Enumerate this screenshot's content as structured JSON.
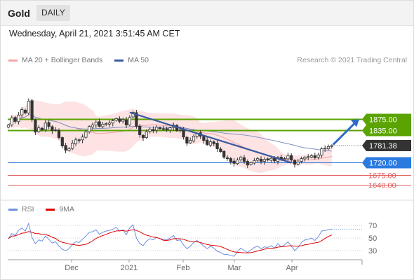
{
  "header": {
    "asset": "Gold",
    "timeframe": "DAILY"
  },
  "timestamp": "Wednesday, April 21, 2021 3:51:45 AM CET",
  "legend": [
    {
      "label": "MA 20 + Bollinger Bands",
      "color": "#f08a8a"
    },
    {
      "label": "MA 50",
      "color": "#3b5aa0"
    }
  ],
  "credit": "Research © 2021 Trading Central",
  "rsi_legend": [
    {
      "label": "RSI",
      "color": "#6f8fe0"
    },
    {
      "label": "9MA",
      "color": "#e00000"
    }
  ],
  "chart_data": [
    {
      "type": "candlestick",
      "x_ticks": [
        "Dec",
        "2021",
        "Feb",
        "Mar",
        "Apr"
      ],
      "closes": [
        1855,
        1880,
        1868,
        1890,
        1910,
        1898,
        1940,
        1875,
        1830,
        1845,
        1838,
        1862,
        1850,
        1835,
        1838,
        1810,
        1780,
        1765,
        1770,
        1790,
        1802,
        1800,
        1812,
        1830,
        1850,
        1855,
        1865,
        1850,
        1858,
        1860,
        1862,
        1870,
        1878,
        1868,
        1875,
        1855,
        1882,
        1900,
        1850,
        1820,
        1810,
        1830,
        1840,
        1835,
        1847,
        1842,
        1840,
        1838,
        1845,
        1855,
        1835,
        1838,
        1812,
        1790,
        1800,
        1815,
        1825,
        1815,
        1800,
        1785,
        1795,
        1788,
        1770,
        1760,
        1740,
        1735,
        1724,
        1718,
        1730,
        1740,
        1725,
        1712,
        1720,
        1728,
        1735,
        1725,
        1732,
        1730,
        1736,
        1727,
        1740,
        1730,
        1735,
        1745,
        1730,
        1715,
        1723,
        1735,
        1740,
        1742,
        1745,
        1738,
        1748,
        1770,
        1772,
        1778,
        1782
      ],
      "levels": [
        {
          "label": "1875.00",
          "value": 1875,
          "color": "#5aa300",
          "kind": "resistance"
        },
        {
          "label": "1835.00",
          "value": 1835,
          "color": "#5aa300",
          "kind": "resistance"
        },
        {
          "label": "1781.38",
          "value": 1781.38,
          "color": "#333333",
          "kind": "last price"
        },
        {
          "label": "1720.00",
          "value": 1720,
          "color": "#2b7ae0",
          "kind": "pivot"
        },
        {
          "label": "1675.00",
          "value": 1675,
          "color": "#e05a5a",
          "kind": "support"
        },
        {
          "label": "1640.00",
          "value": 1640,
          "color": "#e05a5a",
          "kind": "support"
        }
      ],
      "trendline": {
        "from_index": 36,
        "from_value": 1900,
        "to_index": 84,
        "to_value": 1720
      },
      "arrow": {
        "from_value": 1785,
        "to_value": 1875
      }
    },
    {
      "type": "line",
      "title": "RSI",
      "y_ticks": [
        30,
        50,
        70
      ],
      "series": [
        {
          "name": "RSI",
          "values": [
            49,
            57,
            54,
            62,
            66,
            61,
            73,
            51,
            41,
            47,
            45,
            53,
            48,
            42,
            44,
            37,
            32,
            30,
            33,
            40,
            44,
            43,
            48,
            53,
            59,
            60,
            63,
            56,
            59,
            61,
            62,
            64,
            67,
            61,
            63,
            55,
            66,
            71,
            50,
            41,
            38,
            45,
            49,
            47,
            51,
            49,
            48,
            47,
            50,
            54,
            46,
            47,
            39,
            33,
            37,
            43,
            46,
            42,
            37,
            33,
            37,
            34,
            29,
            27,
            24,
            24,
            22,
            21,
            28,
            34,
            30,
            27,
            31,
            35,
            37,
            33,
            36,
            35,
            38,
            34,
            41,
            36,
            39,
            44,
            37,
            30,
            35,
            43,
            47,
            48,
            50,
            46,
            52,
            61,
            62,
            63,
            64
          ]
        },
        {
          "name": "9MA"
        }
      ]
    }
  ]
}
